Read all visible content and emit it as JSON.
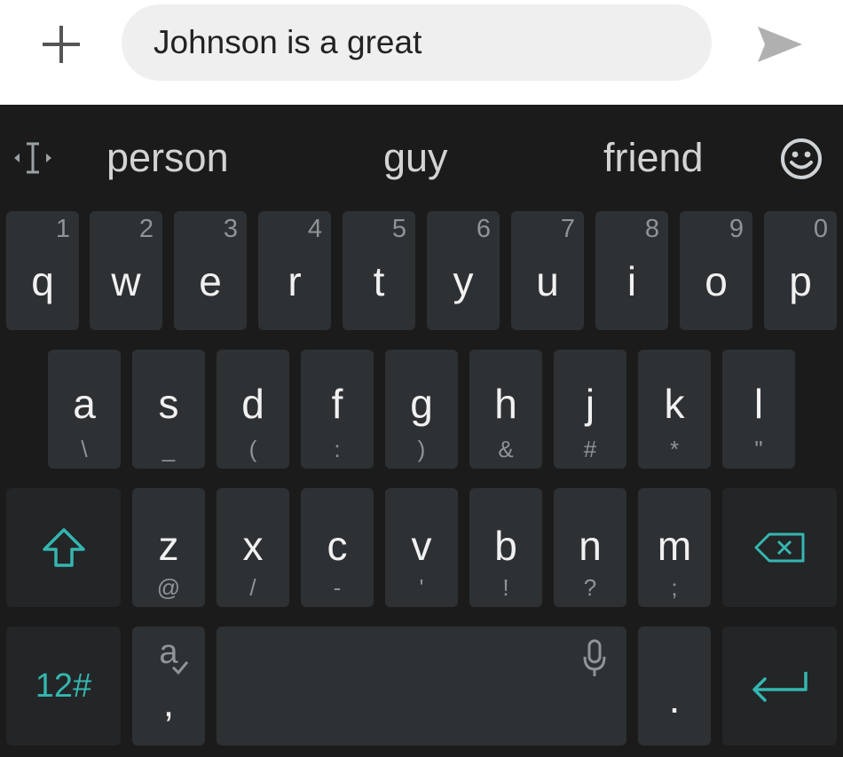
{
  "composer": {
    "message_text": "Johnson is a great",
    "plus_icon": "plus-icon",
    "send_icon": "send-icon"
  },
  "suggestions": {
    "cursor_icon": "text-cursor-icon",
    "words": [
      "person",
      "guy",
      "friend"
    ],
    "emoji_icon": "smiley-icon"
  },
  "keyboard": {
    "row1": [
      {
        "letter": "q",
        "num": "1"
      },
      {
        "letter": "w",
        "num": "2"
      },
      {
        "letter": "e",
        "num": "3"
      },
      {
        "letter": "r",
        "num": "4"
      },
      {
        "letter": "t",
        "num": "5"
      },
      {
        "letter": "y",
        "num": "6"
      },
      {
        "letter": "u",
        "num": "7"
      },
      {
        "letter": "i",
        "num": "8"
      },
      {
        "letter": "o",
        "num": "9"
      },
      {
        "letter": "p",
        "num": "0"
      }
    ],
    "row2": [
      {
        "letter": "a",
        "sub": "\\"
      },
      {
        "letter": "s",
        "sub": "_"
      },
      {
        "letter": "d",
        "sub": "("
      },
      {
        "letter": "f",
        "sub": ":"
      },
      {
        "letter": "g",
        "sub": ")"
      },
      {
        "letter": "h",
        "sub": "&"
      },
      {
        "letter": "j",
        "sub": "#"
      },
      {
        "letter": "k",
        "sub": "*"
      },
      {
        "letter": "l",
        "sub": "\""
      }
    ],
    "row3": [
      {
        "letter": "z",
        "sub": "@"
      },
      {
        "letter": "x",
        "sub": "/"
      },
      {
        "letter": "c",
        "sub": "-"
      },
      {
        "letter": "v",
        "sub": "'"
      },
      {
        "letter": "b",
        "sub": "!"
      },
      {
        "letter": "n",
        "sub": "?"
      },
      {
        "letter": "m",
        "sub": ";"
      }
    ],
    "shift_icon": "shift-arrow-icon",
    "backspace_icon": "backspace-icon",
    "symbols_label": "12#",
    "lang_key": {
      "top": "a",
      "bottom": ","
    },
    "mic_icon": "microphone-icon",
    "period_label": ".",
    "enter_icon": "enter-icon",
    "accent_color": "#35b6b0"
  }
}
